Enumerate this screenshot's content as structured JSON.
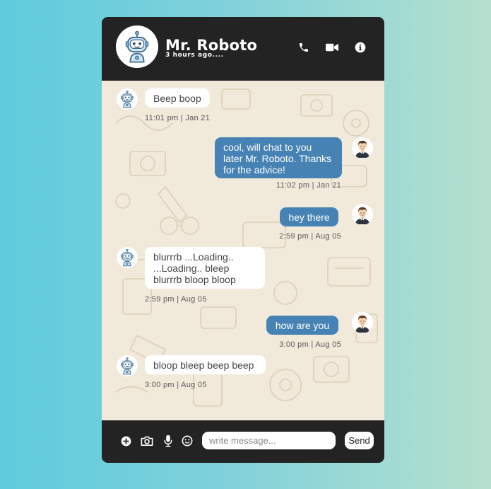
{
  "contact": {
    "name": "Mr. Roboto",
    "status": "3 hours ago...."
  },
  "header_icons": [
    "phone-icon",
    "video-camera-icon",
    "info-icon"
  ],
  "messages": [
    {
      "from": "bot",
      "text": "Beep boop",
      "time": "11:01 pm | Jan 21"
    },
    {
      "from": "user",
      "text": "cool, will chat to you later Mr. Roboto. Thanks for the advice!",
      "time": "11:02 pm | Jan 21"
    },
    {
      "from": "user",
      "text": "hey there",
      "time": "2:59 pm | Aug 05"
    },
    {
      "from": "bot",
      "text": "blurrrb ...Loading.. ...Loading.. bleep blurrrb bloop bloop",
      "time": "2:59 pm | Aug 05"
    },
    {
      "from": "user",
      "text": "how are you",
      "time": "3:00 pm | Aug 05"
    },
    {
      "from": "bot",
      "text": "bloop bleep beep beep",
      "time": "3:00 pm | Aug 05"
    }
  ],
  "composer": {
    "icons": [
      "plus-circle-icon",
      "camera-icon",
      "microphone-icon",
      "smiley-icon"
    ],
    "value": "",
    "placeholder": "write message...",
    "send_label": "Send"
  },
  "colors": {
    "bg_left": "#5ecbdc",
    "bg_right": "#b5e0cd",
    "frame": "#232323",
    "chat_bg": "#f1e9da",
    "user_bubble": "#4682b4",
    "bot_bubble": "#ffffff"
  }
}
